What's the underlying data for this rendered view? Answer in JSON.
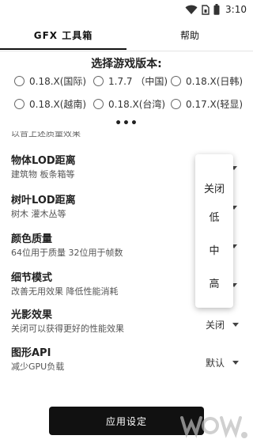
{
  "status_bar": {
    "time": "3:10",
    "icons": [
      "wifi-icon",
      "sim-icon",
      "battery-icon"
    ]
  },
  "tabs": [
    {
      "label": "GFX 工具箱",
      "active": true
    },
    {
      "label": "帮助",
      "active": false
    }
  ],
  "version_section": {
    "title": "选择游戏版本:",
    "options": [
      {
        "label": "0.18.X(国际)"
      },
      {
        "label": "1.7.7 （中国)"
      },
      {
        "label": "0.18.X(日韩)"
      },
      {
        "label": "0.18.X(越南)"
      },
      {
        "label": "0.18.X(台湾)"
      },
      {
        "label": "0.17.X(轻显)"
      }
    ],
    "more": "•••"
  },
  "cut_off_text": "以音上述质量效果",
  "settings": [
    {
      "title": "物体LOD距离",
      "desc": "建筑物 板条箱等",
      "value": ""
    },
    {
      "title": "树叶LOD距离",
      "desc": "树木 灌木丛等",
      "value": ""
    },
    {
      "title": "颜色质量",
      "desc": "64位用于质量 32位用于帧数",
      "value": ""
    },
    {
      "title": "细节模式",
      "desc": "改善无用效果 降低性能消耗",
      "value": ""
    },
    {
      "title": "光影效果",
      "desc": "关闭可以获得更好的性能效果",
      "value": "关闭"
    },
    {
      "title": "图形API",
      "desc": "减少GPU负载",
      "value": "默认"
    }
  ],
  "dropdown_popup": {
    "options": [
      "关闭",
      "低",
      "中",
      "高"
    ]
  },
  "apply_button": {
    "label": "应用设定"
  },
  "colors": {
    "accent": "#111111",
    "background": "#ffffff",
    "text": "#222222"
  }
}
